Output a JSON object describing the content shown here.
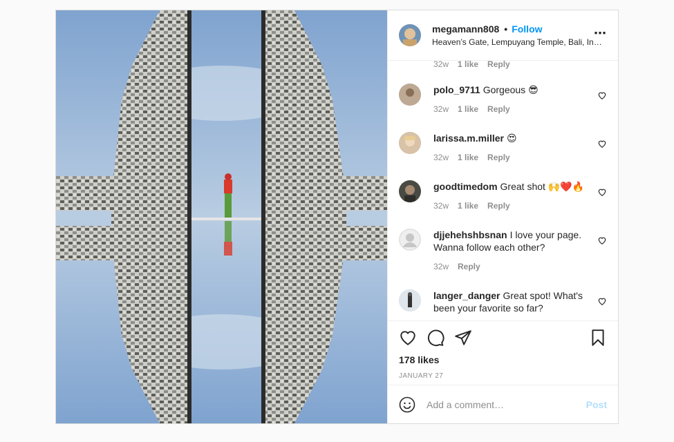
{
  "header": {
    "username": "megamann808",
    "separator": "•",
    "follow_label": "Follow",
    "location": "Heaven’s Gate, Lempuyang Temple, Bali, Indonesia",
    "more_icon": "⋯"
  },
  "partial_comment": {
    "time": "32w",
    "likes": "1 like",
    "reply": "Reply"
  },
  "comments": [
    {
      "username": "polo_9711",
      "text": "Gorgeous 😎",
      "time": "32w",
      "likes": "1 like",
      "reply": "Reply"
    },
    {
      "username": "larissa.m.miller",
      "text": "😍",
      "time": "32w",
      "likes": "1 like",
      "reply": "Reply"
    },
    {
      "username": "goodtimedom",
      "text": "Great shot 🙌❤️🔥",
      "time": "32w",
      "likes": "1 like",
      "reply": "Reply"
    },
    {
      "username": "djjehehshbsnan",
      "text": "I love your page. Wanna follow each other?",
      "time": "32w",
      "likes": "",
      "reply": "Reply"
    },
    {
      "username": "langer_danger",
      "text": "Great spot! What's been your favorite so far?"
    }
  ],
  "likes_count": "178 likes",
  "date": "JANUARY 27",
  "add_comment": {
    "placeholder": "Add a comment…",
    "post_label": "Post"
  },
  "icons": [
    "heart-icon",
    "comment-icon",
    "share-icon",
    "bookmark-icon",
    "smiley-icon",
    "more-icon"
  ],
  "colors": {
    "link_blue": "#0095f6",
    "post_disabled": "#b2dffc",
    "muted": "#8e8e8e"
  }
}
